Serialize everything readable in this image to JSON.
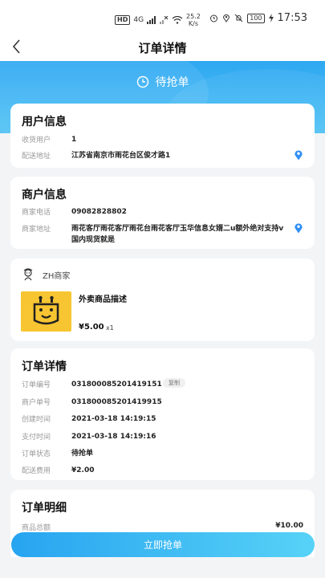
{
  "status_bar": {
    "hd": "HD",
    "network": "4G",
    "speed_value": "25.2",
    "speed_unit": "K/s",
    "battery": "100",
    "time": "17:53"
  },
  "nav": {
    "title": "订单详情"
  },
  "banner": {
    "status": "待抢单"
  },
  "user_info": {
    "title": "用户信息",
    "receiver_label": "收货用户",
    "receiver_value": "1",
    "address_label": "配送地址",
    "address_value": "江苏省南京市雨花台区俊才路1"
  },
  "merchant_info": {
    "title": "商户信息",
    "phone_label": "商家电话",
    "phone_value": "09082828802",
    "address_label": "商家地址",
    "address_value": "雨花客厅雨花客厅雨花台雨花客厅玉华信息女婿二u额外绝对支持v国内现货就是"
  },
  "product": {
    "merchant_name": "ZH商家",
    "name": "外卖商品描述",
    "price": "¥5.00",
    "quantity": "x1"
  },
  "order_detail": {
    "title": "订单详情",
    "rows": [
      {
        "label": "订单编号",
        "value": "031800085201419151"
      },
      {
        "label": "商户单号",
        "value": "031800085201419915"
      },
      {
        "label": "创建时间",
        "value": "2021-03-18 14:19:15"
      },
      {
        "label": "支付时间",
        "value": "2021-03-18 14:19:16"
      },
      {
        "label": "订单状态",
        "value": "待抢单"
      },
      {
        "label": "配送费用",
        "value": "¥2.00"
      }
    ],
    "copy_label": "复制"
  },
  "order_breakdown": {
    "title": "订单明细",
    "total_label": "商品总额",
    "total_value": "¥10.00"
  },
  "action": {
    "grab_label": "立即抢单"
  },
  "colors": {
    "accent_start": "#27a4f0",
    "accent_end": "#57d2f7",
    "location_icon": "#2f8ff5",
    "product_bg": "#f7c531"
  }
}
